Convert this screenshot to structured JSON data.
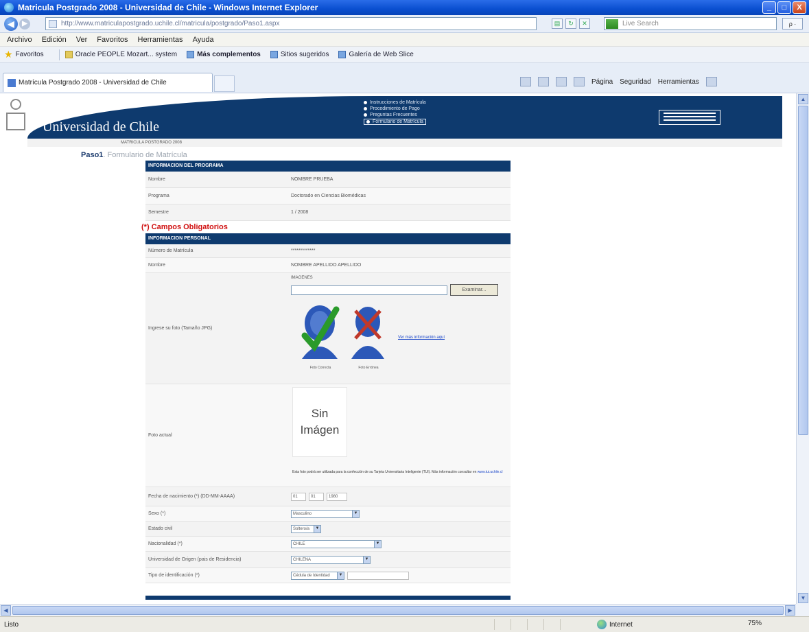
{
  "window": {
    "title": "Matricula Postgrado 2008 - Universidad de Chile - Windows Internet Explorer",
    "minimize": "_",
    "maximize": "□",
    "close": "X"
  },
  "address": {
    "url": "http://www.matriculapostgrado.uchile.cl/matricula/postgrado/Paso1.aspx",
    "search_placeholder": "Live Search",
    "search_go": "ρ ·"
  },
  "menu": [
    "Archivo",
    "Edición",
    "Ver",
    "Favoritos",
    "Herramientas",
    "Ayuda"
  ],
  "favorites": {
    "label": "Favoritos",
    "items": [
      {
        "label": "Oracle PEOPLE Mozart... system",
        "bold": false
      },
      {
        "label": "Más complementos",
        "bold": true
      },
      {
        "label": "Sitios sugeridos",
        "bold": false
      },
      {
        "label": "Galería de Web Slice",
        "bold": false
      }
    ]
  },
  "tab": {
    "label": "Matrícula Postgrado 2008 - Universidad de Chile"
  },
  "commands": [
    "Página",
    "Seguridad",
    "Herramientas"
  ],
  "header": {
    "brand": "Universidad de Chile",
    "links": [
      "Instrucciones de Matrícula",
      "Procedimiento de Pago",
      "Preguntas Frecuentes",
      "Formulario de Matrícula"
    ],
    "subbar": "MATRICULA POSTGRADO 2008"
  },
  "step": {
    "paso": "Paso1",
    "rest": ". Formulario de Matrícula"
  },
  "section1": {
    "title": "INFORMACION DEL PROGRAMA",
    "rows": [
      {
        "label": "Nombre",
        "value": "NOMBRE PRUEBA"
      },
      {
        "label": "Programa",
        "value": "Doctorado en Ciencias Biomédicas"
      },
      {
        "label": "Semestre",
        "value": "1 / 2008"
      }
    ]
  },
  "required_note": "(*) Campos Obligatorios",
  "section2": {
    "title": "INFORMACION PERSONAL",
    "rows": [
      {
        "label": "Número de Matrícula",
        "value": "*************"
      },
      {
        "label": "Nombre",
        "value": "NOMBRE APELLIDO APELLIDO"
      }
    ],
    "photo_label": "Ingrese su foto (Tamaño JPG)",
    "photo_title": "IMAGENES",
    "browse": "Examinar...",
    "good_caption": "Foto Correcta",
    "bad_caption": "Foto Errónea",
    "ver_link": "Ver más información aquí",
    "foto_actual": "Foto actual",
    "sin_imagen": [
      "Sin",
      "Imágen"
    ],
    "note": "Esta foto podrá ser utilizada para la confección de su Tarjeta Universitaria Inteligente (TUI). Más información consultar en",
    "note_link": "www.tui.uchile.cl",
    "fields": [
      {
        "label": "Fecha de nacimiento (*) (DD-MM-AAAA)",
        "type": "date",
        "values": [
          "01",
          "01",
          "1980"
        ]
      },
      {
        "label": "Sexo (*)",
        "type": "select",
        "value": "Masculino",
        "width": 100
      },
      {
        "label": "Estado civil",
        "type": "select",
        "value": "Soltero/a",
        "width": 44
      },
      {
        "label": "Nacionalidad (*)",
        "type": "select",
        "value": "CHILE",
        "width": 132
      },
      {
        "label": "Universidad de Origen (pais de Residencia)",
        "type": "select",
        "value": "CHILENA",
        "width": 116
      },
      {
        "label": "Tipo de identificación (*)",
        "type": "select",
        "value": "Cédula de Identidad",
        "width": 78
      }
    ]
  },
  "status": {
    "left": "Listo",
    "zone": "Internet",
    "zoom": "75%"
  }
}
